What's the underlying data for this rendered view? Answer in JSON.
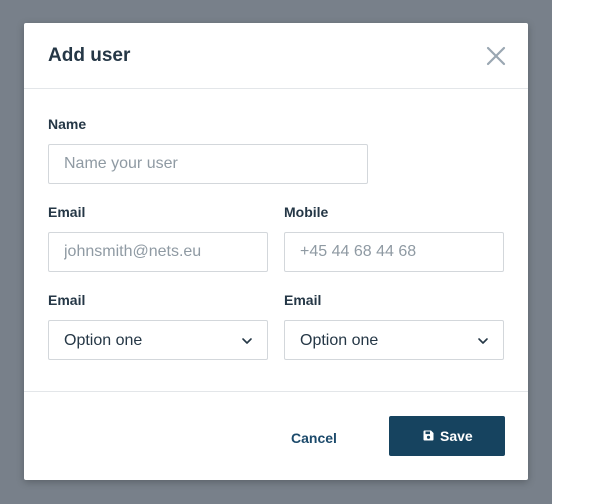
{
  "modal": {
    "title": "Add user",
    "close_icon": "close-icon"
  },
  "form": {
    "name": {
      "label": "Name",
      "placeholder": "Name your user",
      "value": ""
    },
    "email": {
      "label": "Email",
      "placeholder": "johnsmith@nets.eu",
      "value": ""
    },
    "mobile": {
      "label": "Mobile",
      "placeholder": "+45 44 68 44 68",
      "value": ""
    },
    "select_left": {
      "label": "Email",
      "selected": "Option one",
      "icon": "chevron-down-icon"
    },
    "select_right": {
      "label": "Email",
      "selected": "Option one",
      "icon": "chevron-down-icon"
    }
  },
  "footer": {
    "cancel_label": "Cancel",
    "save_label": "Save",
    "save_icon": "floppy-disk-icon"
  },
  "colors": {
    "backdrop": "#78808a",
    "primary": "#16435f",
    "text": "#253746",
    "link": "#1c4a6b",
    "placeholder": "#8f9aa3",
    "border": "#d3d7db"
  }
}
